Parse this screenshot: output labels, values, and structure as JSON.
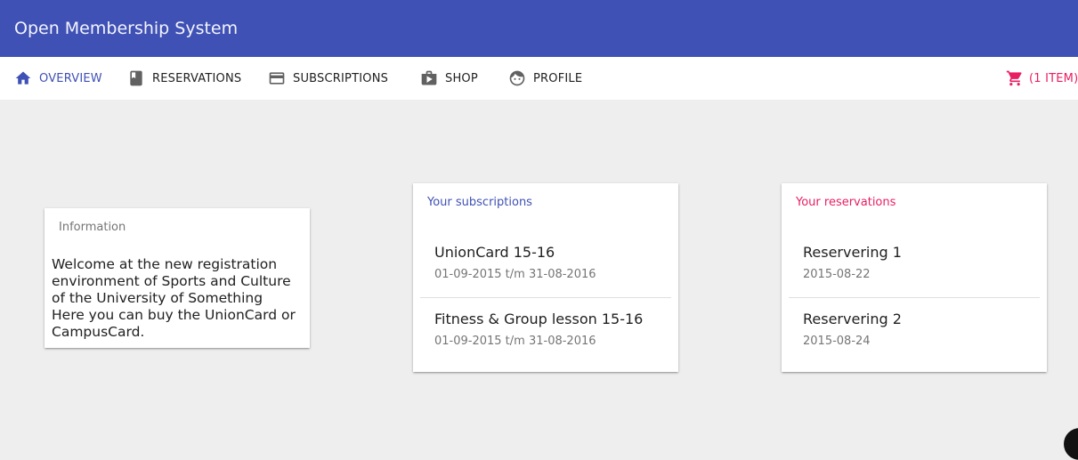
{
  "app": {
    "title": "Open Membership System"
  },
  "nav": {
    "tabs": [
      {
        "label": "OVERVIEW",
        "icon": "home-icon",
        "active": true
      },
      {
        "label": "RESERVATIONS",
        "icon": "book-icon"
      },
      {
        "label": "SUBSCRIPTIONS",
        "icon": "credit-card-icon"
      },
      {
        "label": "SHOP",
        "icon": "shop-icon"
      },
      {
        "label": "PROFILE",
        "icon": "face-icon"
      }
    ],
    "cart": {
      "label": "(1 ITEM)",
      "icon": "cart-icon"
    }
  },
  "colors": {
    "primary": "#3f51b5",
    "accent": "#e91e63",
    "background": "#eeeeee"
  },
  "info_card": {
    "title": "Information",
    "lines": [
      "Welcome at the new registration environment of Sports and Culture of the University of Something",
      "Here you can buy the UnionCard or CampusCard."
    ]
  },
  "subscriptions_card": {
    "title": "Your subscriptions",
    "items": [
      {
        "name": "UnionCard 15-16",
        "period": "01-09-2015 t/m 31-08-2016"
      },
      {
        "name": "Fitness & Group lesson 15-16",
        "period": "01-09-2015 t/m 31-08-2016"
      }
    ]
  },
  "reservations_card": {
    "title": "Your reservations",
    "items": [
      {
        "name": "Reservering 1",
        "date": "2015-08-22"
      },
      {
        "name": "Reservering 2",
        "date": "2015-08-24"
      }
    ]
  }
}
